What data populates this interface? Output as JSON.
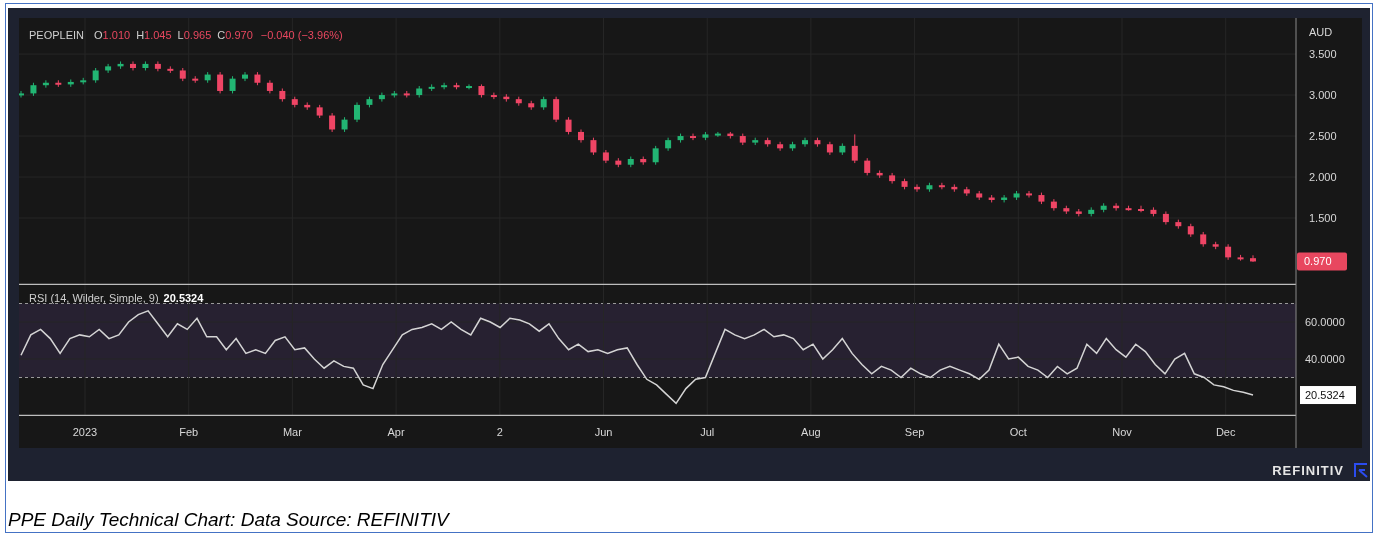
{
  "price_chart": {
    "legend": {
      "symbol": "PEOPLEIN",
      "fields": [
        {
          "key": "O",
          "value": "1.010"
        },
        {
          "key": "H",
          "value": "1.045"
        },
        {
          "key": "L",
          "value": "0.965"
        },
        {
          "key": "C",
          "value": "0.970"
        }
      ],
      "change": "−0.040 (−3.96%)"
    },
    "currency": "AUD",
    "last_price": "0.970",
    "chart_data": {
      "type": "candlestick",
      "grid": true,
      "ylim": [
        0.695,
        3.94
      ],
      "yticks": [
        {
          "value": 1.5,
          "label": "1.500"
        },
        {
          "value": 2,
          "label": "2.000"
        },
        {
          "value": 2.5,
          "label": "2.500"
        },
        {
          "value": 3,
          "label": "3.000"
        },
        {
          "value": 3.5,
          "label": "3.500"
        }
      ],
      "ohlc": [
        [
          3.0,
          3.05,
          2.97,
          3.02
        ],
        [
          3.02,
          3.15,
          2.99,
          3.12
        ],
        [
          3.12,
          3.18,
          3.09,
          3.15
        ],
        [
          3.15,
          3.18,
          3.1,
          3.13
        ],
        [
          3.13,
          3.19,
          3.1,
          3.16
        ],
        [
          3.16,
          3.21,
          3.13,
          3.18
        ],
        [
          3.18,
          3.33,
          3.15,
          3.3
        ],
        [
          3.3,
          3.38,
          3.27,
          3.35
        ],
        [
          3.35,
          3.41,
          3.32,
          3.38
        ],
        [
          3.38,
          3.41,
          3.3,
          3.33
        ],
        [
          3.33,
          3.41,
          3.3,
          3.38
        ],
        [
          3.38,
          3.41,
          3.29,
          3.32
        ],
        [
          3.32,
          3.35,
          3.27,
          3.3
        ],
        [
          3.3,
          3.33,
          3.17,
          3.2
        ],
        [
          3.2,
          3.23,
          3.15,
          3.18
        ],
        [
          3.18,
          3.28,
          3.15,
          3.25
        ],
        [
          3.25,
          3.28,
          3.02,
          3.05
        ],
        [
          3.05,
          3.23,
          3.02,
          3.2
        ],
        [
          3.2,
          3.28,
          3.17,
          3.25
        ],
        [
          3.25,
          3.28,
          3.12,
          3.15
        ],
        [
          3.15,
          3.18,
          3.02,
          3.05
        ],
        [
          3.05,
          3.08,
          2.92,
          2.95
        ],
        [
          2.95,
          2.98,
          2.85,
          2.88
        ],
        [
          2.88,
          2.91,
          2.82,
          2.85
        ],
        [
          2.85,
          2.88,
          2.72,
          2.75
        ],
        [
          2.75,
          2.78,
          2.55,
          2.58
        ],
        [
          2.58,
          2.73,
          2.55,
          2.7
        ],
        [
          2.7,
          2.91,
          2.67,
          2.88
        ],
        [
          2.88,
          2.98,
          2.85,
          2.95
        ],
        [
          2.95,
          3.03,
          2.92,
          3.0
        ],
        [
          3.0,
          3.05,
          2.97,
          3.02
        ],
        [
          3.02,
          3.05,
          2.97,
          3.0
        ],
        [
          3.0,
          3.11,
          2.97,
          3.08
        ],
        [
          3.08,
          3.13,
          3.05,
          3.1
        ],
        [
          3.1,
          3.15,
          3.07,
          3.12
        ],
        [
          3.12,
          3.15,
          3.07,
          3.1
        ],
        [
          3.1,
          3.13,
          3.07,
          3.11
        ],
        [
          3.11,
          3.13,
          2.97,
          3.0
        ],
        [
          3.0,
          3.03,
          2.95,
          2.98
        ],
        [
          2.98,
          3.01,
          2.92,
          2.95
        ],
        [
          2.95,
          2.98,
          2.87,
          2.9
        ],
        [
          2.9,
          2.93,
          2.82,
          2.85
        ],
        [
          2.85,
          2.98,
          2.82,
          2.95
        ],
        [
          2.95,
          2.98,
          2.67,
          2.7
        ],
        [
          2.7,
          2.73,
          2.52,
          2.55
        ],
        [
          2.55,
          2.58,
          2.42,
          2.45
        ],
        [
          2.45,
          2.48,
          2.27,
          2.3
        ],
        [
          2.3,
          2.33,
          2.17,
          2.2
        ],
        [
          2.2,
          2.23,
          2.12,
          2.15
        ],
        [
          2.15,
          2.25,
          2.12,
          2.22
        ],
        [
          2.22,
          2.25,
          2.15,
          2.18
        ],
        [
          2.18,
          2.38,
          2.15,
          2.35
        ],
        [
          2.35,
          2.48,
          2.32,
          2.45
        ],
        [
          2.45,
          2.53,
          2.42,
          2.5
        ],
        [
          2.5,
          2.53,
          2.45,
          2.48
        ],
        [
          2.48,
          2.55,
          2.45,
          2.52
        ],
        [
          2.52,
          2.55,
          2.49,
          2.53
        ],
        [
          2.53,
          2.55,
          2.47,
          2.5
        ],
        [
          2.5,
          2.53,
          2.39,
          2.42
        ],
        [
          2.42,
          2.48,
          2.39,
          2.45
        ],
        [
          2.45,
          2.48,
          2.37,
          2.4
        ],
        [
          2.4,
          2.43,
          2.32,
          2.35
        ],
        [
          2.35,
          2.43,
          2.32,
          2.4
        ],
        [
          2.4,
          2.48,
          2.37,
          2.45
        ],
        [
          2.45,
          2.48,
          2.37,
          2.4
        ],
        [
          2.4,
          2.43,
          2.27,
          2.3
        ],
        [
          2.3,
          2.41,
          2.27,
          2.38
        ],
        [
          2.38,
          2.52,
          2.17,
          2.2
        ],
        [
          2.2,
          2.23,
          2.02,
          2.05
        ],
        [
          2.05,
          2.08,
          1.99,
          2.02
        ],
        [
          2.02,
          2.05,
          1.92,
          1.95
        ],
        [
          1.95,
          1.98,
          1.85,
          1.88
        ],
        [
          1.88,
          1.91,
          1.82,
          1.85
        ],
        [
          1.85,
          1.93,
          1.82,
          1.9
        ],
        [
          1.9,
          1.93,
          1.85,
          1.88
        ],
        [
          1.88,
          1.91,
          1.82,
          1.85
        ],
        [
          1.85,
          1.88,
          1.77,
          1.8
        ],
        [
          1.8,
          1.83,
          1.72,
          1.75
        ],
        [
          1.75,
          1.78,
          1.69,
          1.72
        ],
        [
          1.72,
          1.78,
          1.69,
          1.75
        ],
        [
          1.75,
          1.83,
          1.72,
          1.8
        ],
        [
          1.8,
          1.83,
          1.75,
          1.78
        ],
        [
          1.78,
          1.81,
          1.67,
          1.7
        ],
        [
          1.7,
          1.73,
          1.59,
          1.62
        ],
        [
          1.62,
          1.65,
          1.55,
          1.58
        ],
        [
          1.58,
          1.61,
          1.52,
          1.55
        ],
        [
          1.55,
          1.63,
          1.52,
          1.6
        ],
        [
          1.6,
          1.68,
          1.57,
          1.65
        ],
        [
          1.65,
          1.68,
          1.59,
          1.62
        ],
        [
          1.62,
          1.65,
          1.59,
          1.61
        ],
        [
          1.61,
          1.65,
          1.57,
          1.6
        ],
        [
          1.6,
          1.63,
          1.52,
          1.55
        ],
        [
          1.55,
          1.58,
          1.42,
          1.45
        ],
        [
          1.45,
          1.48,
          1.37,
          1.4
        ],
        [
          1.4,
          1.43,
          1.27,
          1.3
        ],
        [
          1.3,
          1.33,
          1.15,
          1.18
        ],
        [
          1.18,
          1.21,
          1.12,
          1.15
        ],
        [
          1.15,
          1.18,
          0.99,
          1.02
        ],
        [
          1.02,
          1.05,
          0.98,
          1.01
        ],
        [
          1.01,
          1.045,
          0.965,
          0.97
        ]
      ]
    }
  },
  "rsi_panel": {
    "value": "20.5324",
    "last_value": "20.5324",
    "chart_data": {
      "type": "line",
      "grid": true,
      "ylim": [
        9.7,
        80
      ],
      "yticks": [
        {
          "value": 40,
          "label": "40.0000"
        },
        {
          "value": 60,
          "label": "60.0000"
        }
      ],
      "series": [
        {
          "name": "RSI (14, Wilder, Simple, 9)",
          "values": [
            42,
            53,
            56,
            51,
            43,
            51,
            53,
            52,
            56,
            51,
            53,
            60,
            64,
            66,
            59,
            52,
            59,
            56,
            62,
            52,
            52,
            45,
            51,
            43,
            45,
            43,
            50,
            52,
            45,
            46,
            40,
            35,
            39,
            36,
            35,
            26,
            24,
            37,
            45,
            53,
            56,
            57,
            59,
            56,
            60,
            56,
            53,
            62,
            60,
            57,
            62,
            61,
            59,
            55,
            59,
            51,
            45,
            48,
            44,
            45,
            43,
            45,
            46,
            37,
            29,
            26,
            21,
            16,
            24,
            29,
            30,
            43,
            56,
            53,
            51,
            53,
            56,
            52,
            53,
            51,
            45,
            48,
            40,
            45,
            51,
            43,
            37,
            32,
            36,
            34,
            30,
            35,
            32,
            30,
            34,
            36,
            34,
            32,
            29,
            34,
            48,
            40,
            41,
            36,
            34,
            30,
            36,
            32,
            35,
            48,
            43,
            51,
            45,
            41,
            48,
            44,
            37,
            32,
            40,
            43,
            32,
            30,
            26,
            25,
            23,
            22,
            20.5
          ]
        }
      ]
    }
  },
  "time_axis": [
    "2023",
    "Feb",
    "Mar",
    "Apr",
    "2",
    "Jun",
    "Jul",
    "Aug",
    "Sep",
    "Oct",
    "Nov",
    "Dec"
  ],
  "branding": "REFINITIV",
  "caption": "PPE Daily Technical Chart: Data Source: REFINITIV"
}
